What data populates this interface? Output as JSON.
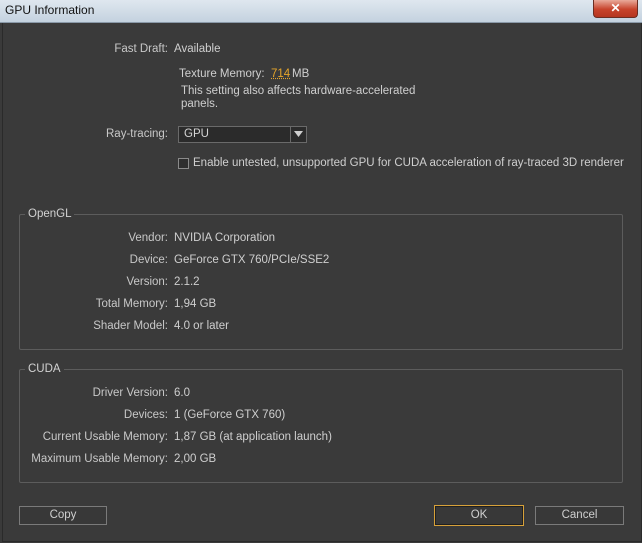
{
  "window": {
    "title": "GPU Information",
    "close_glyph": "✕"
  },
  "general": {
    "fast_draft_label": "Fast Draft:",
    "fast_draft_value": "Available",
    "texture_memory_label": "Texture Memory:",
    "texture_memory_value": "714",
    "texture_memory_unit": "MB",
    "note_line1": "This setting also affects hardware-accelerated",
    "note_line2": "panels.",
    "raytracing_label": "Ray-tracing:",
    "raytracing_value": "GPU",
    "checkbox_label": "Enable untested, unsupported GPU for CUDA acceleration of ray-traced 3D renderer",
    "checkbox_checked": false
  },
  "opengl": {
    "title": "OpenGL",
    "rows": [
      {
        "label": "Vendor:",
        "value": "NVIDIA Corporation"
      },
      {
        "label": "Device:",
        "value": "GeForce GTX 760/PCIe/SSE2"
      },
      {
        "label": "Version:",
        "value": "2.1.2"
      },
      {
        "label": "Total Memory:",
        "value": "1,94 GB"
      },
      {
        "label": "Shader Model:",
        "value": "4.0 or later"
      }
    ]
  },
  "cuda": {
    "title": "CUDA",
    "rows": [
      {
        "label": "Driver Version:",
        "value": "6.0"
      },
      {
        "label": "Devices:",
        "value": "1 (GeForce GTX 760)"
      },
      {
        "label": "Current Usable Memory:",
        "value": "1,87 GB (at application launch)"
      },
      {
        "label": "Maximum Usable Memory:",
        "value": "2,00 GB"
      }
    ]
  },
  "buttons": {
    "copy": "Copy",
    "ok": "OK",
    "cancel": "Cancel"
  },
  "colors": {
    "accent": "#e6a52a",
    "background": "#3a3a3a"
  }
}
